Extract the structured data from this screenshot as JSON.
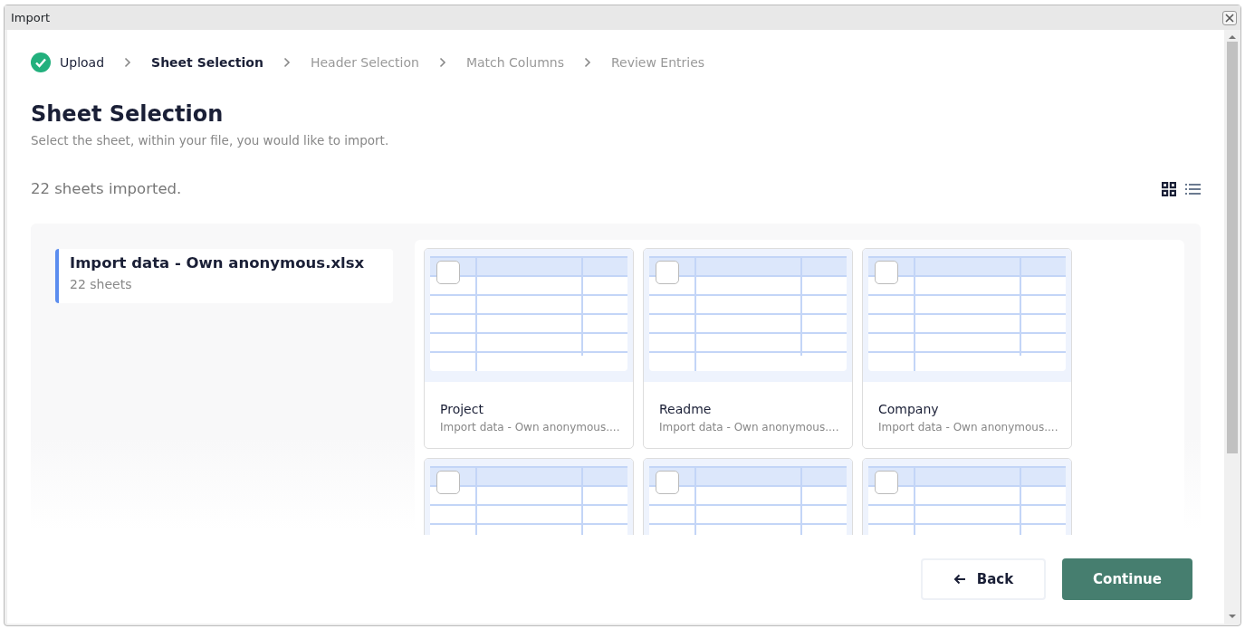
{
  "window": {
    "title": "Import"
  },
  "steps": [
    {
      "label": "Upload",
      "kind": "done"
    },
    {
      "label": "Sheet Selection",
      "kind": "current"
    },
    {
      "label": "Header Selection",
      "kind": "upcoming"
    },
    {
      "label": "Match Columns",
      "kind": "upcoming"
    },
    {
      "label": "Review Entries",
      "kind": "upcoming"
    }
  ],
  "heading": "Sheet Selection",
  "subtitle": "Select the sheet, within your file, you would like to import.",
  "summary": "22 sheets imported.",
  "view_toggle": [
    {
      "kind": "grid",
      "selected": true
    },
    {
      "kind": "list",
      "selected": false
    }
  ],
  "files": [
    {
      "name": "Import data - Own anonymous.xlsx",
      "count": "22 sheets",
      "selected": true
    }
  ],
  "sheets": [
    {
      "name": "Project",
      "file": "Import data - Own anonymous....",
      "checked": false
    },
    {
      "name": "Readme",
      "file": "Import data - Own anonymous....",
      "checked": false
    },
    {
      "name": "Company",
      "file": "Import data - Own anonymous....",
      "checked": false
    },
    {
      "checked": false
    },
    {
      "checked": false
    },
    {
      "checked": false
    }
  ],
  "buttons": [
    {
      "kind": "back",
      "label": "Back"
    },
    {
      "kind": "primary",
      "label": "Continue"
    }
  ]
}
